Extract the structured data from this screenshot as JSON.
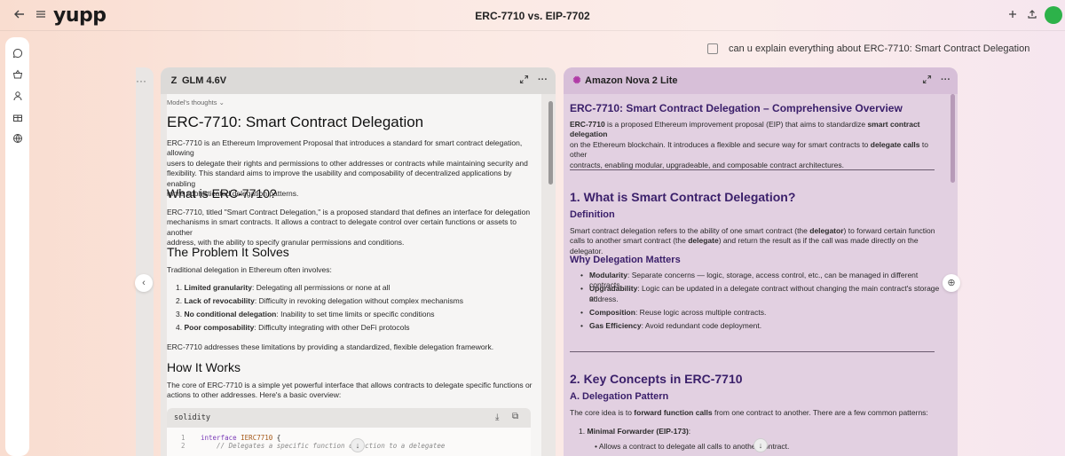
{
  "topbar": {
    "back_icon": "back-arrow-icon",
    "menu_icon": "hamburger-icon",
    "logo": "yupp",
    "title": "ERC-7710 vs. EIP-7702",
    "new_icon": "plus-icon",
    "share_icon": "share-icon"
  },
  "sidebar": {
    "items": [
      {
        "icon": "chat-icon"
      },
      {
        "icon": "basket-icon"
      },
      {
        "icon": "user-icon"
      },
      {
        "icon": "gift-icon"
      },
      {
        "icon": "globe-icon"
      }
    ]
  },
  "prompt": {
    "text": "can u explain everything about ERC-7710: Smart Contract Delegation"
  },
  "left_panel": {
    "model": "GLM 4.6V",
    "brand_glyph": "Z",
    "thoughts_label": "Model's thoughts",
    "h1": "ERC-7710: Smart Contract Delegation",
    "intro_lines": [
      "ERC-7710 is an Ethereum Improvement Proposal that introduces a standard for smart contract delegation, allowing",
      "users to delegate their rights and permissions to other addresses or contracts while maintaining security and",
      "flexibility. This standard aims to improve the usability and composability of decentralized applications by enabling",
      "more sophisticated delegation patterns."
    ],
    "h2_what": "What is ERC-7710?",
    "what_lines": [
      "ERC-7710, titled \"Smart Contract Delegation,\" is a proposed standard that defines an interface for delegation",
      "mechanisms in smart contracts. It allows a contract to delegate control over certain functions or assets to another",
      "address, with the ability to specify granular permissions and conditions."
    ],
    "h2_problem": "The Problem It Solves",
    "problem_intro": "Traditional delegation in Ethereum often involves:",
    "problems": [
      {
        "num": "1.",
        "bold": "Limited granularity",
        "rest": ": Delegating all permissions or none at all"
      },
      {
        "num": "2.",
        "bold": "Lack of revocability",
        "rest": ": Difficulty in revoking delegation without complex mechanisms"
      },
      {
        "num": "3.",
        "bold": "No conditional delegation",
        "rest": ": Inability to set time limits or specific conditions"
      },
      {
        "num": "4.",
        "bold": "Poor composability",
        "rest": ": Difficulty integrating with other DeFi protocols"
      }
    ],
    "problem_outro": "ERC-7710 addresses these limitations by providing a standardized, flexible delegation framework.",
    "h2_how": "How It Works",
    "how_lines": [
      "The core of ERC-7710 is a simple yet powerful interface that allows contracts to delegate specific functions or",
      "actions to other addresses. Here's a basic overview:"
    ],
    "code": {
      "lang": "solidity",
      "line1_num": "1",
      "line2_num": "2",
      "line1_kw": "interface",
      "line1_cls": "IERC7710",
      "line1_rest": " {",
      "line2_comment": "    // Delegates a specific function or action to a delegatee"
    }
  },
  "right_panel": {
    "model": "Amazon Nova 2 Lite",
    "title": "ERC-7710: Smart Contract Delegation – Comprehensive Overview",
    "intro": {
      "l1_b1": "ERC-7710",
      "l1_t1": " is a proposed Ethereum improvement proposal (EIP) that aims to standardize ",
      "l1_b2": "smart contract delegation",
      "l2_t1": "on the Ethereum blockchain. It introduces a flexible and secure way for smart contracts to ",
      "l2_b1": "delegate calls",
      "l2_t2": " to other",
      "l3": "contracts, enabling modular, upgradeable, and composable contract architectures."
    },
    "section1": "1. What is Smart Contract Delegation?",
    "definition_h": "Definition",
    "definition": {
      "l1_t1": "Smart contract delegation refers to the ability of one smart contract (the ",
      "l1_b1": "delegator",
      "l1_t2": ") to forward certain function",
      "l2_t1": "calls to another smart contract (the ",
      "l2_b1": "delegate",
      "l2_t2": ") and return the result as if the call was made directly on the delegator."
    },
    "why_h": "Why Delegation Matters",
    "why_items": [
      {
        "bold": "Modularity",
        "rest": ": Separate concerns — logic, storage, access control, etc., can be managed in different contracts."
      },
      {
        "bold": "Upgradability",
        "rest": ": Logic can be updated in a delegate contract without changing the main contract's storage or"
      },
      {
        "bold": "",
        "rest": "address."
      },
      {
        "bold": "Composition",
        "rest": ": Reuse logic across multiple contracts."
      },
      {
        "bold": "Gas Efficiency",
        "rest": ": Avoid redundant code deployment."
      }
    ],
    "section2": "2. Key Concepts in ERC-7710",
    "pattern_h": "A. Delegation Pattern",
    "pattern": {
      "t1": "The core idea is to ",
      "b1": "forward function calls",
      "t2": " from one contract to another. There are a few common patterns:"
    },
    "pattern_items": [
      {
        "num": "1.",
        "bold": "Minimal Forwarder (EIP-173)",
        "rest": ":"
      }
    ],
    "sub_item": "Allows a contract to delegate all calls to another contract."
  }
}
